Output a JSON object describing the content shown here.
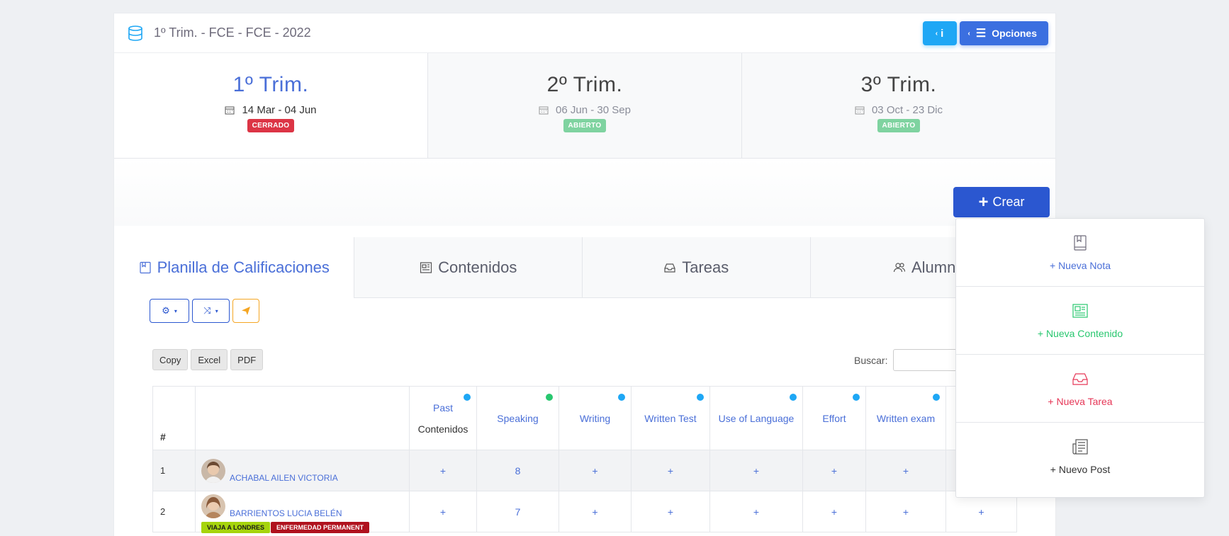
{
  "header": {
    "title": "1º Trim. - FCE - FCE - 2022",
    "info_label": "i",
    "options_label": "Opciones"
  },
  "trimesters": [
    {
      "name": "1º Trim.",
      "dates": "14 Mar - 04 Jun",
      "status": "CERRADO",
      "active": true
    },
    {
      "name": "2º Trim.",
      "dates": "06 Jun - 30 Sep",
      "status": "ABIERTO",
      "active": false
    },
    {
      "name": "3º Trim.",
      "dates": "03 Oct - 23 Dic",
      "status": "ABIERTO",
      "active": false
    }
  ],
  "crear_label": "Crear",
  "tabs": [
    {
      "label": "Planilla de Calificaciones",
      "icon": "book-icon"
    },
    {
      "label": "Contenidos",
      "icon": "newspaper-icon"
    },
    {
      "label": "Tareas",
      "icon": "inbox-icon"
    },
    {
      "label": "Alumnos",
      "icon": "users-icon"
    }
  ],
  "exports": {
    "copy": "Copy",
    "excel": "Excel",
    "pdf": "PDF"
  },
  "search": {
    "label": "Buscar:"
  },
  "table": {
    "num_header": "#",
    "columns": [
      {
        "label": "Past",
        "sub": "Contenidos",
        "dot": "#1ea7f5"
      },
      {
        "label": "Speaking",
        "sub": "",
        "dot": "#28c76f"
      },
      {
        "label": "Writing",
        "sub": "",
        "dot": "#1ea7f5"
      },
      {
        "label": "Written Test",
        "sub": "",
        "dot": "#1ea7f5"
      },
      {
        "label": "Use of Language",
        "sub": "",
        "dot": "#1ea7f5"
      },
      {
        "label": "Effort",
        "sub": "",
        "dot": "#1ea7f5"
      },
      {
        "label": "Written exam",
        "sub": "",
        "dot": "#1ea7f5"
      }
    ],
    "rows": [
      {
        "index": "1",
        "name": "ACHABAL AILEN VICTORIA",
        "grades": [
          "+",
          "8",
          "+",
          "+",
          "+",
          "+",
          "+"
        ],
        "tags": []
      },
      {
        "index": "2",
        "name": "BARRIENTOS LUCIA BELÉN",
        "grades": [
          "+",
          "7",
          "+",
          "+",
          "+",
          "+",
          "+",
          "+"
        ],
        "tags": [
          "VIAJA A LONDRES",
          "ENFERMEDAD PERMANENT"
        ]
      }
    ]
  },
  "dropdown": {
    "nota": "Nueva Nota",
    "contenido": "Nueva Contenido",
    "tarea": "Nueva Tarea",
    "post": "Nuevo Post"
  }
}
